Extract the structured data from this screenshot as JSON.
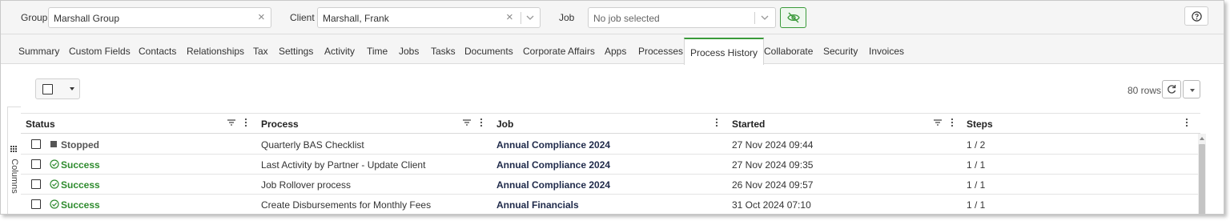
{
  "header": {
    "group_label": "Group",
    "group_value": "Marshall Group",
    "client_label": "Client",
    "client_value": "Marshall, Frank",
    "job_label": "Job",
    "job_placeholder": "No job selected",
    "accent_color": "#3a9a3a"
  },
  "tabs": [
    {
      "label": "Summary"
    },
    {
      "label": "Custom Fields"
    },
    {
      "label": "Contacts"
    },
    {
      "label": "Relationships"
    },
    {
      "label": "Tax"
    },
    {
      "label": "Settings"
    },
    {
      "label": "Activity"
    },
    {
      "label": "Time"
    },
    {
      "label": "Jobs"
    },
    {
      "label": "Tasks"
    },
    {
      "label": "Documents"
    },
    {
      "label": "Corporate Affairs"
    },
    {
      "label": "Apps"
    },
    {
      "label": "Processes"
    },
    {
      "label": "Process History",
      "active": true
    },
    {
      "label": "Collaborate"
    },
    {
      "label": "Security"
    },
    {
      "label": "Invoices"
    }
  ],
  "toolbar": {
    "rows_count": "80 rows"
  },
  "side_panel": {
    "columns_label": "Columns"
  },
  "grid": {
    "columns": [
      "Status",
      "Process",
      "Job",
      "Started",
      "Steps"
    ],
    "rows": [
      {
        "status": "Stopped",
        "process": "Quarterly BAS Checklist",
        "job": "Annual Compliance 2024",
        "started": "27 Nov 2024 09:44",
        "steps": "1 / 2"
      },
      {
        "status": "Success",
        "process": "Last Activity by Partner - Update Client",
        "job": "Annual Compliance 2024",
        "started": "27 Nov 2024 09:35",
        "steps": "1 / 1"
      },
      {
        "status": "Success",
        "process": "Job Rollover process",
        "job": "Annual Compliance 2024",
        "started": "26 Nov 2024 09:57",
        "steps": "1 / 1"
      },
      {
        "status": "Success",
        "process": "Create Disbursements for Monthly Fees",
        "job": "Annual Financials",
        "started": "31 Oct 2024 07:10",
        "steps": "1 / 1"
      }
    ],
    "status_colors": {
      "Stopped": "#555555",
      "Success": "#2e8b2e"
    }
  }
}
